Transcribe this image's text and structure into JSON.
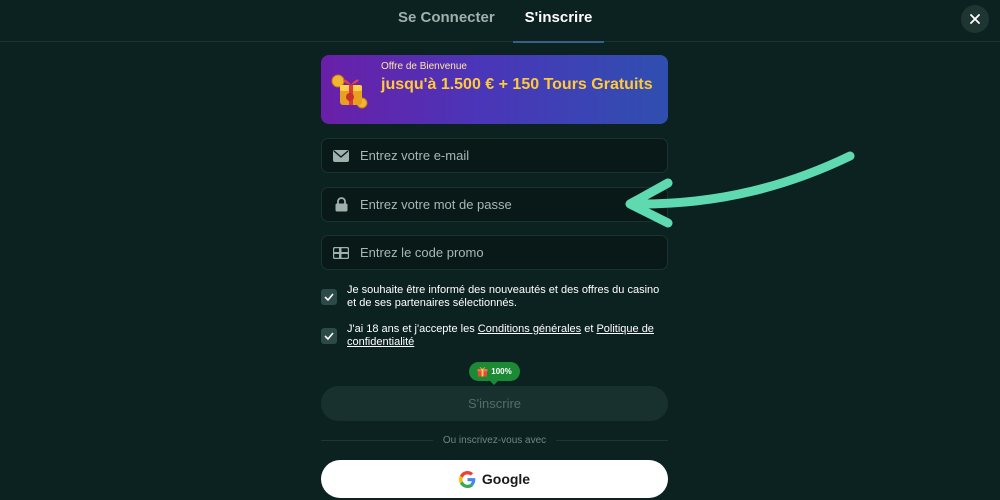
{
  "tabs": {
    "login": "Se Connecter",
    "signup": "S'inscrire"
  },
  "banner": {
    "small": "Offre de Bienvenue",
    "main": "jusqu'à 1.500 € + 150 Tours Gratuits"
  },
  "fields": {
    "email_placeholder": "Entrez votre e-mail",
    "password_placeholder": "Entrez votre mot de passe",
    "promo_placeholder": "Entrez le code promo"
  },
  "consent": {
    "news": "Je souhaite être informé des nouveautés et des offres du casino et de ses partenaires sélectionnés.",
    "age_prefix": "J'ai 18 ans et j'accepte les ",
    "terms_link": "Conditions générales",
    "and": " et ",
    "privacy_link": "Politique de confidentialité"
  },
  "badge": {
    "text": "100%"
  },
  "submit_label": "S'inscrire",
  "divider_text": "Ou inscrivez-vous avec",
  "google_label": "Google",
  "colors": {
    "background": "#0c2220",
    "accent_arrow": "#5fd9b0",
    "banner_text": "#ffc93a",
    "badge": "#1c8a35"
  },
  "icons": {
    "close": "close-icon",
    "email": "envelope-icon",
    "password": "lock-icon",
    "promo": "gift-card-icon",
    "checkbox": "checkmark-icon",
    "google": "google-logo-icon"
  }
}
